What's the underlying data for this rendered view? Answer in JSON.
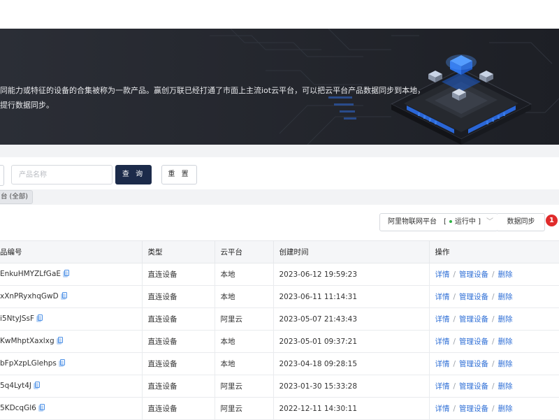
{
  "banner": {
    "line1": "同能力或特征的设备的合集被称为一款产品。赢创万联已经打通了市面上主流iot云平台，可以把云平台产品数据同步到本地，",
    "line2": "提行数据同步。"
  },
  "search": {
    "product_name_placeholder": "产品名称",
    "query_label": "查 询",
    "reset_label": "重 置",
    "filter_tag": "台 (全部)"
  },
  "toolbar": {
    "platform_name": "阿里物联网平台",
    "platform_status_open": "[",
    "platform_status_text": "运行中 ]",
    "sync_label": "数据同步",
    "badge_count": "1",
    "status_color": "#2fb344"
  },
  "table": {
    "headers": [
      "品编号",
      "类型",
      "云平台",
      "创建时间",
      "操作"
    ],
    "rows": [
      {
        "id": "EnkuHMYZLfGaE",
        "type": "直连设备",
        "platform": "本地",
        "created": "2023-06-12 19:59:23"
      },
      {
        "id": "xXnPRyxhqGwD",
        "type": "直连设备",
        "platform": "本地",
        "created": "2023-06-11 11:14:31"
      },
      {
        "id": "i5NtyJSsF",
        "type": "直连设备",
        "platform": "阿里云",
        "created": "2023-05-07 21:43:43"
      },
      {
        "id": "KwMhptXaxlxg",
        "type": "直连设备",
        "platform": "本地",
        "created": "2023-05-01 09:37:21"
      },
      {
        "id": "bFpXzpLGlehps",
        "type": "直连设备",
        "platform": "本地",
        "created": "2023-04-18 09:28:15"
      },
      {
        "id": "5q4Lyt4J",
        "type": "直连设备",
        "platform": "阿里云",
        "created": "2023-01-30 15:33:28"
      },
      {
        "id": "5KDcqGl6",
        "type": "直连设备",
        "platform": "阿里云",
        "created": "2022-12-11 14:30:11"
      }
    ],
    "actions": {
      "detail": "详情",
      "manage": "管理设备",
      "delete": "删除",
      "separator": "/"
    }
  },
  "colors": {
    "banner_bg": "#22242b",
    "primary_button": "#1c2b4a",
    "link": "#2f6fd6",
    "badge": "#e02b2b",
    "copy_icon": "#4a8fe6"
  },
  "icons": {
    "copy": "copy-icon",
    "dropdown": "chevron-down-icon",
    "banner_art": "chip-illustration"
  }
}
